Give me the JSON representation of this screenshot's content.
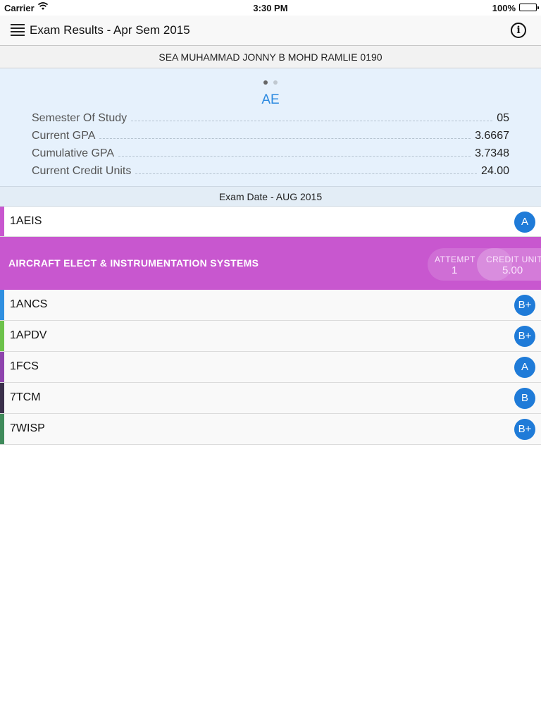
{
  "status": {
    "carrier": "Carrier",
    "time": "3:30 PM",
    "battery": "100%"
  },
  "nav": {
    "title": "Exam Results - Apr Sem 2015"
  },
  "student": {
    "name": "SEA MUHAMMAD JONNY B MOHD RAMLIE 0190"
  },
  "summary": {
    "program": "AE",
    "rows": [
      {
        "label": "Semester Of Study",
        "value": "05"
      },
      {
        "label": "Current GPA",
        "value": "3.6667"
      },
      {
        "label": "Cumulative GPA",
        "value": "3.7348"
      },
      {
        "label": "Current Credit Units",
        "value": "24.00"
      }
    ],
    "page_count": 2,
    "active_page": 1
  },
  "exam_date": "Exam Date - AUG 2015",
  "subjects": [
    {
      "code": "1AEIS",
      "grade": "A",
      "color": "#c857cf"
    },
    {
      "code": "1ANCS",
      "grade": "B+",
      "color": "#2f8fe0"
    },
    {
      "code": "1APDV",
      "grade": "B+",
      "color": "#6cc24a"
    },
    {
      "code": "1FCS",
      "grade": "A",
      "color": "#8e44ad"
    },
    {
      "code": "7TCM",
      "grade": "B",
      "color": "#3a2f4a"
    },
    {
      "code": "7WISP",
      "grade": "B+",
      "color": "#3f8a5a"
    }
  ],
  "expanded": {
    "name": "AIRCRAFT ELECT & INSTRUMENTATION SYSTEMS",
    "attempt_label": "ATTEMPT",
    "attempt_value": "1",
    "credit_label": "CREDIT UNIT",
    "credit_value": "5.00"
  },
  "colors": {
    "accent": "#2c8ae0",
    "grade_badge": "#1f7bd8",
    "summary_bg": "#e6f1fc"
  }
}
